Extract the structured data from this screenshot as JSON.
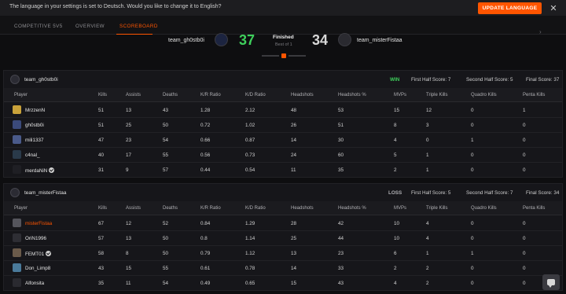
{
  "banner": {
    "message": "The language in your settings is set to Deutsch. Would you like to change it to English?",
    "update_label": "UPDATE LANGUAGE",
    "close_label": "✕"
  },
  "tabs": [
    {
      "label": "COMPETITIVE 5V5",
      "active": false
    },
    {
      "label": "OVERVIEW",
      "active": false
    },
    {
      "label": "SCOREBOARD",
      "active": true
    }
  ],
  "header": {
    "team1": "team_gh0stb0i",
    "team1_score": "37",
    "team2": "team_misterFistaa",
    "team2_score": "34",
    "status": "Finished",
    "status_sub": "Best of 1",
    "right_mark": "›"
  },
  "columns": [
    "Player",
    "Kills",
    "Assists",
    "Deaths",
    "K/R Ratio",
    "K/D Ratio",
    "Headshots",
    "Headshots %",
    "MVPs",
    "Triple Kills",
    "Quadro Kills",
    "Penta Kills"
  ],
  "teams": [
    {
      "name": "team_gh0stb0i",
      "result": "WIN",
      "first_half": "First Half Score: 7",
      "second_half": "Second Half Score: 5",
      "final": "Final Score: 37",
      "players": [
        {
          "name": "MrzzenN",
          "verified": false,
          "highlight": false,
          "color": "#c9a23a",
          "stats": [
            "51",
            "13",
            "43",
            "1.28",
            "2.12",
            "48",
            "53",
            "15",
            "12",
            "0",
            "1"
          ]
        },
        {
          "name": "gh0stb0i",
          "verified": false,
          "highlight": false,
          "color": "#3b4a7a",
          "stats": [
            "51",
            "25",
            "50",
            "0.72",
            "1.02",
            "26",
            "51",
            "8",
            "3",
            "0",
            "0"
          ]
        },
        {
          "name": "mili1337",
          "verified": false,
          "highlight": false,
          "color": "#4a5a8a",
          "stats": [
            "47",
            "23",
            "54",
            "0.66",
            "0.87",
            "14",
            "30",
            "4",
            "0",
            "1",
            "0"
          ]
        },
        {
          "name": "c4nal_",
          "verified": false,
          "highlight": false,
          "color": "#2a3a4a",
          "stats": [
            "40",
            "17",
            "55",
            "0.56",
            "0.73",
            "24",
            "60",
            "5",
            "1",
            "0",
            "0"
          ]
        },
        {
          "name": "merdaNiN",
          "verified": true,
          "highlight": false,
          "color": "#1f1f24",
          "stats": [
            "31",
            "9",
            "57",
            "0.44",
            "0.54",
            "11",
            "35",
            "2",
            "1",
            "0",
            "0"
          ]
        }
      ]
    },
    {
      "name": "team_misterFistaa",
      "result": "LOSS",
      "first_half": "First Half Score: 5",
      "second_half": "Second Half Score: 7",
      "final": "Final Score: 34",
      "players": [
        {
          "name": "misterFistaa",
          "verified": false,
          "highlight": true,
          "color": "#55555c",
          "stats": [
            "67",
            "12",
            "52",
            "0.84",
            "1.29",
            "28",
            "42",
            "10",
            "4",
            "0",
            "0"
          ]
        },
        {
          "name": "OriN1996",
          "verified": false,
          "highlight": false,
          "color": "#2e2e34",
          "stats": [
            "57",
            "13",
            "50",
            "0.8",
            "1.14",
            "25",
            "44",
            "10",
            "4",
            "0",
            "0"
          ]
        },
        {
          "name": "FEMT01",
          "verified": true,
          "highlight": false,
          "color": "#6a5a4a",
          "stats": [
            "58",
            "8",
            "50",
            "0.79",
            "1.12",
            "13",
            "23",
            "6",
            "1",
            "1",
            "0"
          ]
        },
        {
          "name": "Don_Limp8",
          "verified": false,
          "highlight": false,
          "color": "#4a7a9a",
          "stats": [
            "43",
            "15",
            "55",
            "0.61",
            "0.78",
            "14",
            "33",
            "2",
            "2",
            "0",
            "0"
          ]
        },
        {
          "name": "Alfonsita",
          "verified": false,
          "highlight": false,
          "color": "#2a2a30",
          "stats": [
            "35",
            "11",
            "54",
            "0.49",
            "0.65",
            "15",
            "43",
            "4",
            "2",
            "0",
            "0"
          ]
        }
      ]
    }
  ]
}
